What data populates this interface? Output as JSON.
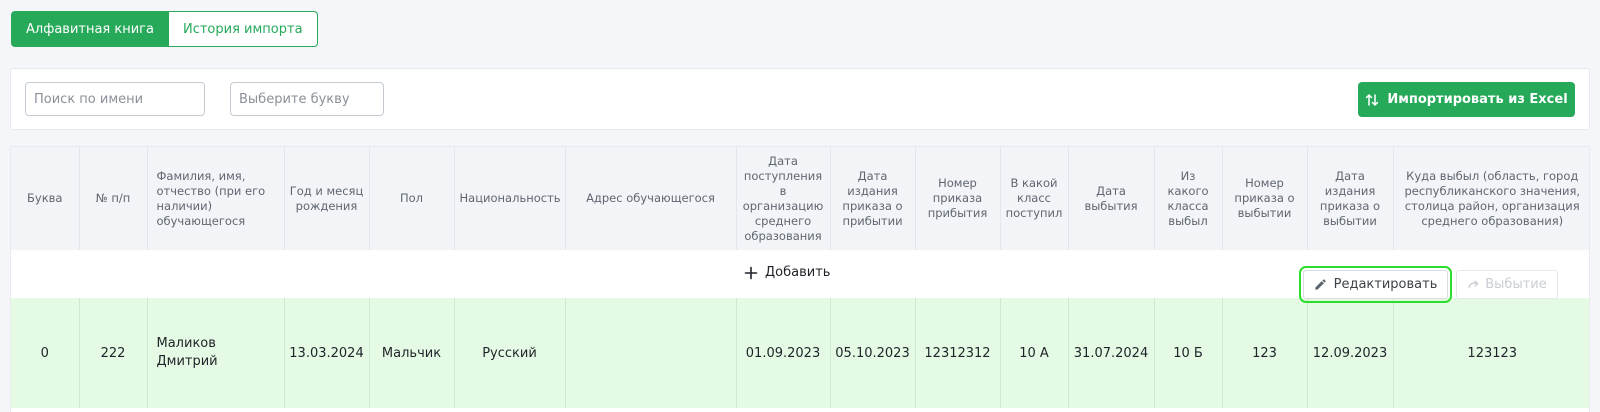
{
  "tabs": [
    {
      "label": "Алфавитная книга",
      "active": true
    },
    {
      "label": "История импорта",
      "active": false
    }
  ],
  "toolbar": {
    "search_placeholder": "Поиск по имени",
    "letter_placeholder": "Выберите букву",
    "import_label": "Импортировать из Excel"
  },
  "table": {
    "columns": [
      "Буква",
      "№ п/п",
      "Фамилия, имя, отчество (при его наличии) обучающегося",
      "Год и месяц рождения",
      "Пол",
      "Национальность",
      "Адрес обучающегося",
      "Дата поступления в организацию среднего образования",
      "Дата издания приказа о прибытии",
      "Номер приказа прибытия",
      "В какой класс поступил",
      "Дата выбытия",
      "Из какого класса выбыл",
      "Номер приказа о выбытии",
      "Дата издания приказа о выбытии",
      "Куда выбыл (область, город республиканского значения, столица район, организация среднего образования)"
    ],
    "add_label": "Добавить",
    "edit_label": "Редактировать",
    "leave_label": "Выбытие",
    "rows": [
      {
        "letter": "0",
        "num": "222",
        "name": "Маликов Дмитрий",
        "birth": "13.03.2024",
        "gender": "Мальчик",
        "nationality": "Русский",
        "address": "",
        "admission_date": "01.09.2023",
        "arrival_order_date": "05.10.2023",
        "arrival_order_num": "12312312",
        "class_in": "10 А",
        "leave_date": "31.07.2024",
        "class_out": "10 Б",
        "leave_order_num": "123",
        "leave_order_date": "12.09.2023",
        "destination": "123123"
      }
    ]
  },
  "colors": {
    "accent": "#27a95a",
    "row_highlight": "#e4fae4",
    "focus_outline": "#2cdd2c"
  },
  "icons": {
    "import": "arrows-up-down-icon",
    "add": "plus-icon",
    "edit": "pencil-icon",
    "leave": "redo-arrow-icon"
  }
}
